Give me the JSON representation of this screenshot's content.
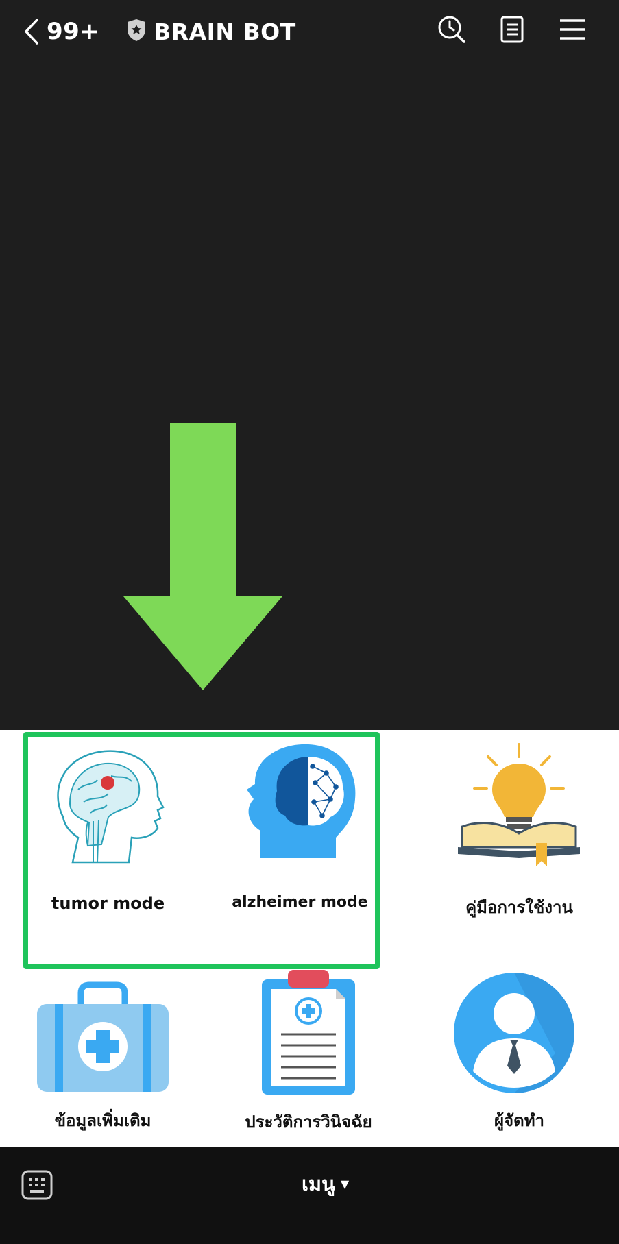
{
  "header": {
    "back_count": "99+",
    "title": "BRAIN BOT",
    "icons": [
      "back-chevron-icon",
      "shield-star-icon",
      "search-history-icon",
      "notes-icon",
      "hamburger-menu-icon"
    ]
  },
  "rich_menu": {
    "items": [
      {
        "label": "tumor mode",
        "icon": "brain-tumor-icon"
      },
      {
        "label": "alzheimer mode",
        "icon": "brain-network-icon"
      },
      {
        "label": "คู่มือการใช้งาน",
        "icon": "lightbulb-book-icon"
      },
      {
        "label": "ข้อมูลเพิ่มเติม",
        "icon": "medical-kit-icon"
      },
      {
        "label": "ประวัติการวินิจฉัย",
        "icon": "clipboard-icon"
      },
      {
        "label": "ผู้จัดทำ",
        "icon": "user-avatar-icon"
      }
    ]
  },
  "bottom_bar": {
    "menu_label": "เมนู",
    "caret": "▼"
  },
  "colors": {
    "background": "#1e1e1e",
    "arrow": "#7ed957",
    "highlight": "#1fc45b",
    "accent_blue": "#3aa9f2"
  }
}
